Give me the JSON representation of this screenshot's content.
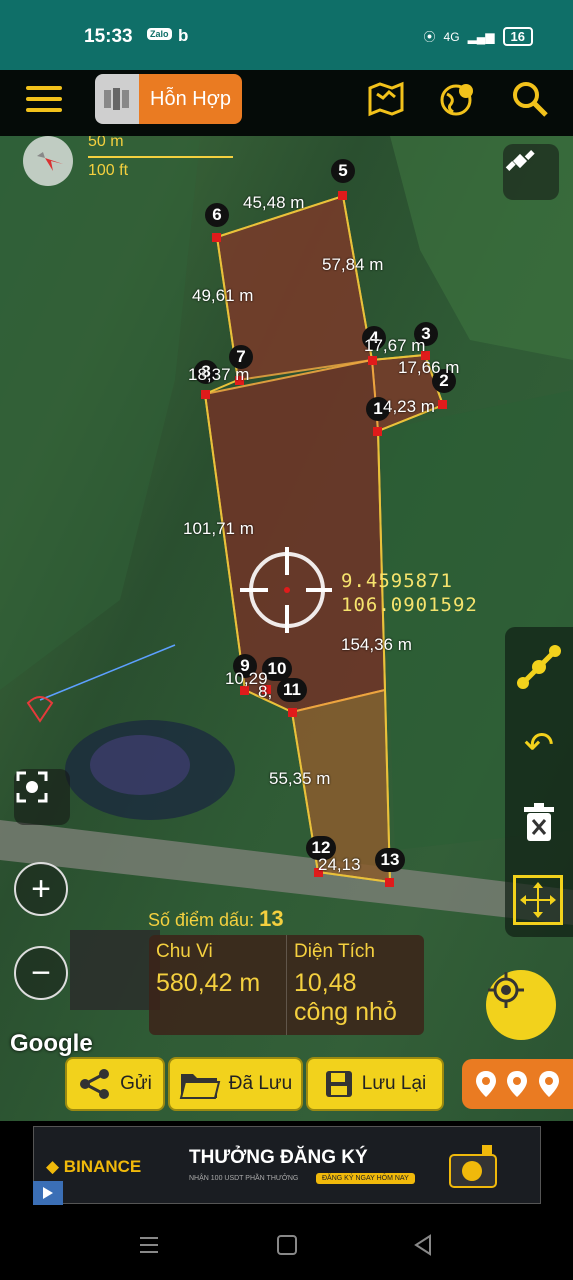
{
  "status_bar": {
    "time": "15:33",
    "apps": [
      "Zalo",
      "b"
    ],
    "network": "4G",
    "battery": "16"
  },
  "toolbar": {
    "map_mode_label": "Hỗn Hợp"
  },
  "map": {
    "scale_top": "50 m",
    "scale_bottom": "100 ft",
    "points": [
      "1",
      "2",
      "3",
      "4",
      "5",
      "6",
      "7",
      "8",
      "9",
      "10",
      "11",
      "12",
      "13"
    ],
    "distances": [
      "45,48 m",
      "57,84 m",
      "49,61 m",
      "17,67 m",
      "17,66 m",
      "18,37 m",
      "4,23 m",
      "101,71 m",
      "154,36 m",
      "10,29",
      "8,",
      "55,35 m",
      "24,13"
    ],
    "coordinates": {
      "lat": "9.4595871",
      "lng": "106.0901592"
    },
    "google_logo": "Google"
  },
  "stats": {
    "points_label": "Số điểm dấu:",
    "points_count": "13",
    "perimeter_label": "Chu Vi",
    "perimeter_value": "580,42 m",
    "area_label": "Diện Tích",
    "area_value": "10,48",
    "area_unit": "công nhỏ"
  },
  "actions": {
    "send": "Gửi",
    "saved": "Đã Lưu",
    "save": "Lưu Lại"
  },
  "ad": {
    "brand": "BINANCE",
    "headline": "THƯỞNG ĐĂNG KÝ",
    "sub": "NHẬN 100 USDT PHẦN THƯỞNG",
    "cta": "ĐĂNG KÝ NGAY HÔM NAY"
  },
  "colors": {
    "accent": "#f2d21c",
    "header": "#0f6f68",
    "orange": "#ea7b22",
    "plot": "#7a3b2a"
  }
}
